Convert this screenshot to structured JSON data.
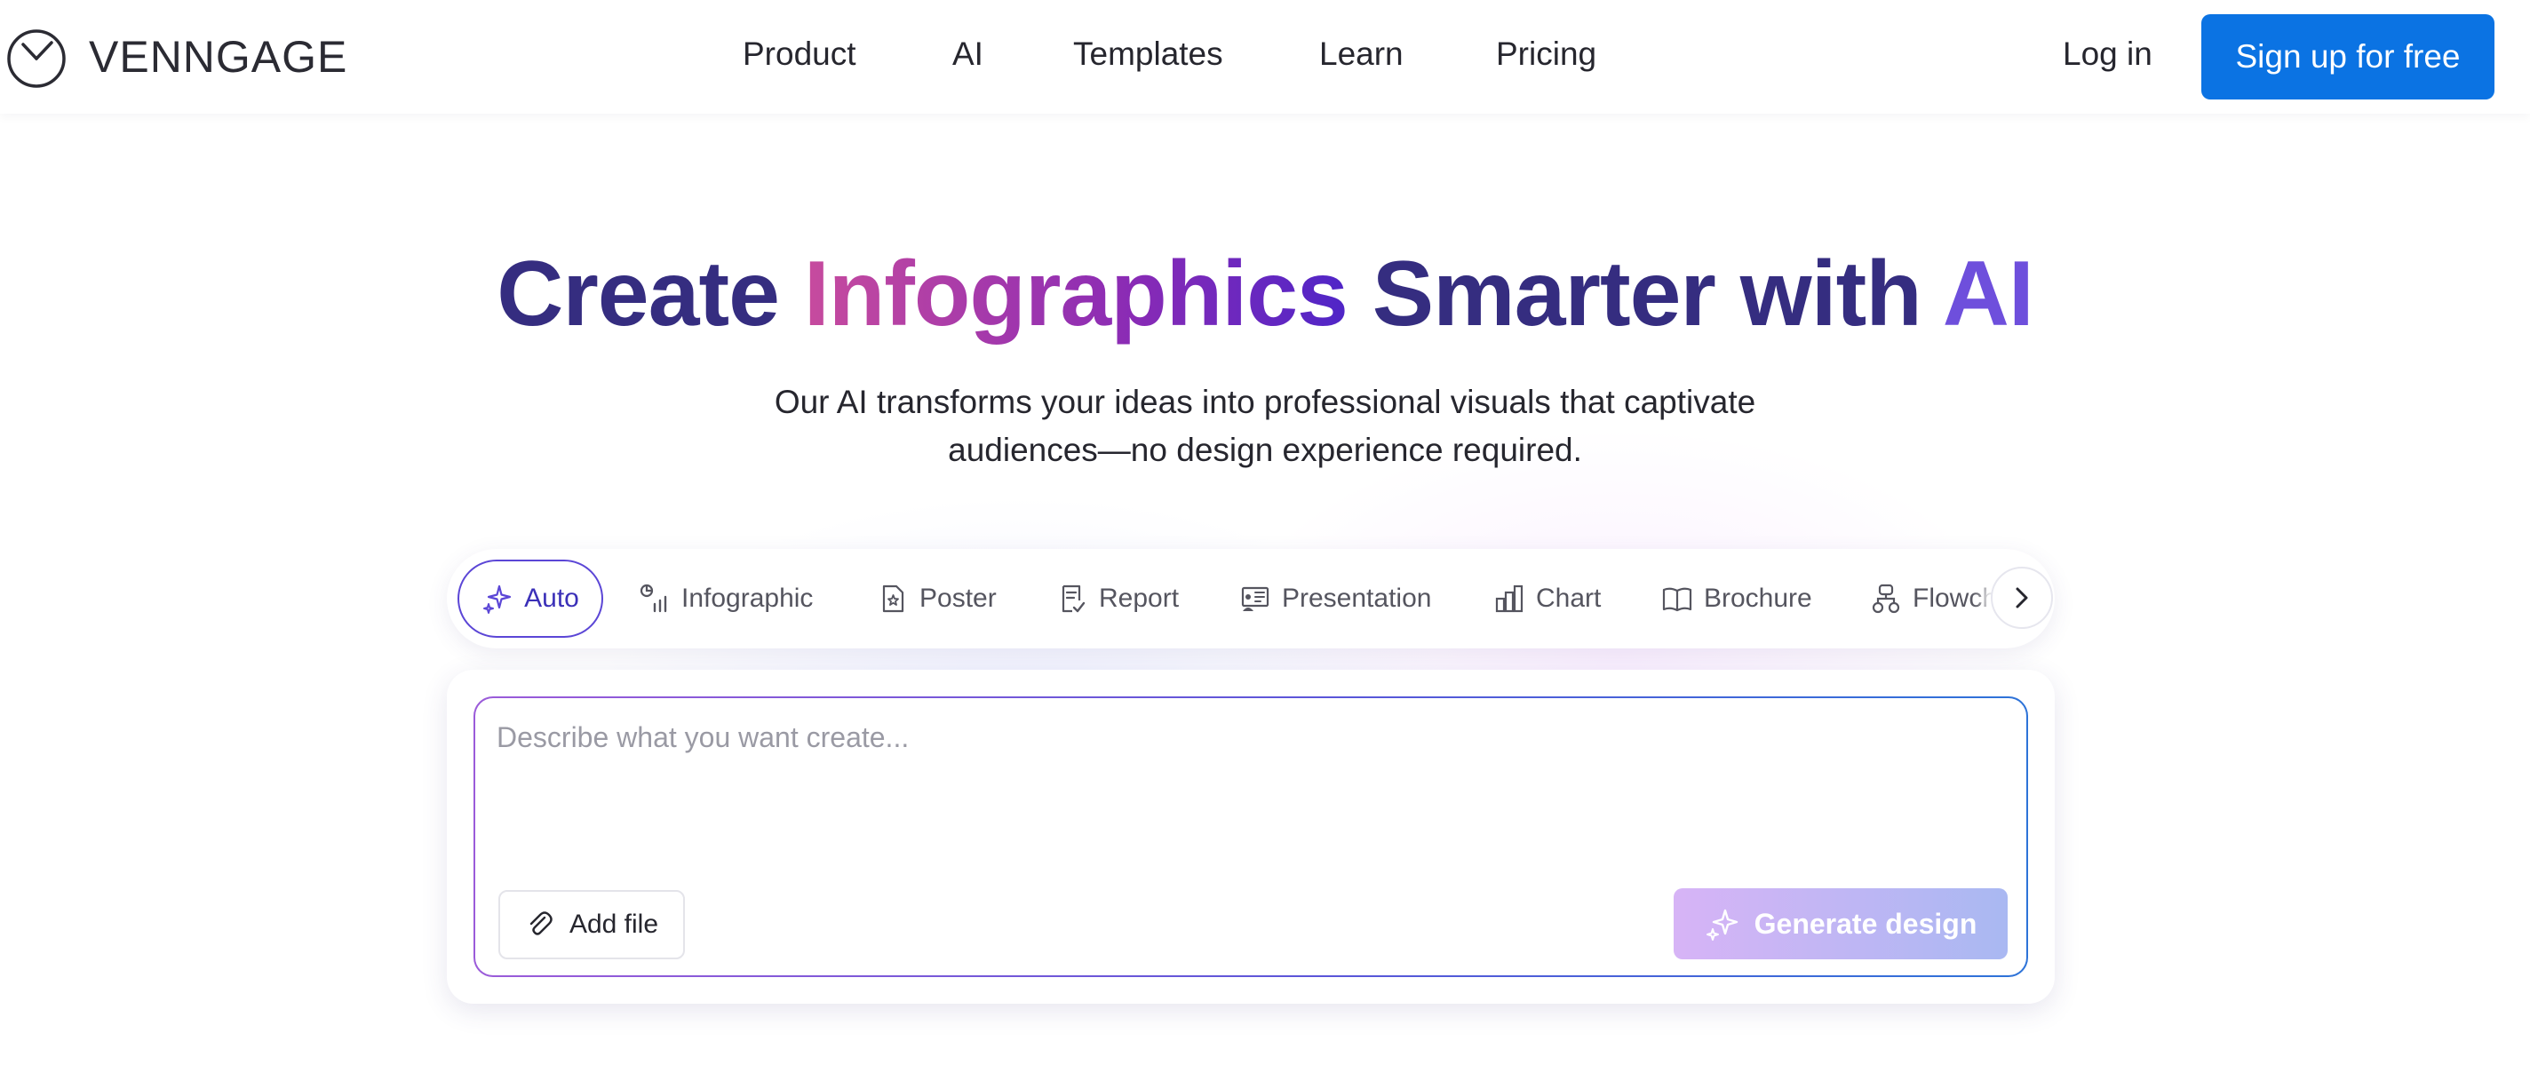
{
  "header": {
    "logo_text": "VENNGAGE",
    "nav": [
      "Product",
      "AI",
      "Templates",
      "Learn",
      "Pricing"
    ],
    "login_label": "Log in",
    "signup_label": "Sign up for free"
  },
  "hero": {
    "title_part1": "Create ",
    "title_highlight": "Infographics",
    "title_part2": " Smarter with ",
    "title_ai": "AI",
    "subtitle_line1": "Our AI transforms your ideas into professional visuals that captivate",
    "subtitle_line2": "audiences—no design experience required."
  },
  "tabs": {
    "items": [
      {
        "label": "Auto",
        "icon": "sparkle-icon",
        "active": true
      },
      {
        "label": "Infographic",
        "icon": "infographic-icon"
      },
      {
        "label": "Poster",
        "icon": "poster-icon"
      },
      {
        "label": "Report",
        "icon": "report-icon"
      },
      {
        "label": "Presentation",
        "icon": "presentation-icon"
      },
      {
        "label": "Chart",
        "icon": "chart-icon"
      },
      {
        "label": "Brochure",
        "icon": "brochure-icon"
      },
      {
        "label": "Flowchart",
        "icon": "flowchart-icon"
      }
    ],
    "next_icon": "chevron-right-icon"
  },
  "prompt": {
    "placeholder": "Describe what you want create...",
    "value": "",
    "add_file_label": "Add file",
    "generate_label": "Generate design"
  },
  "colors": {
    "brand_blue": "#0b73e3",
    "title_purple": "#352d80",
    "ai_violet": "#6e4fdc",
    "tab_active_border": "#5b46d6"
  }
}
